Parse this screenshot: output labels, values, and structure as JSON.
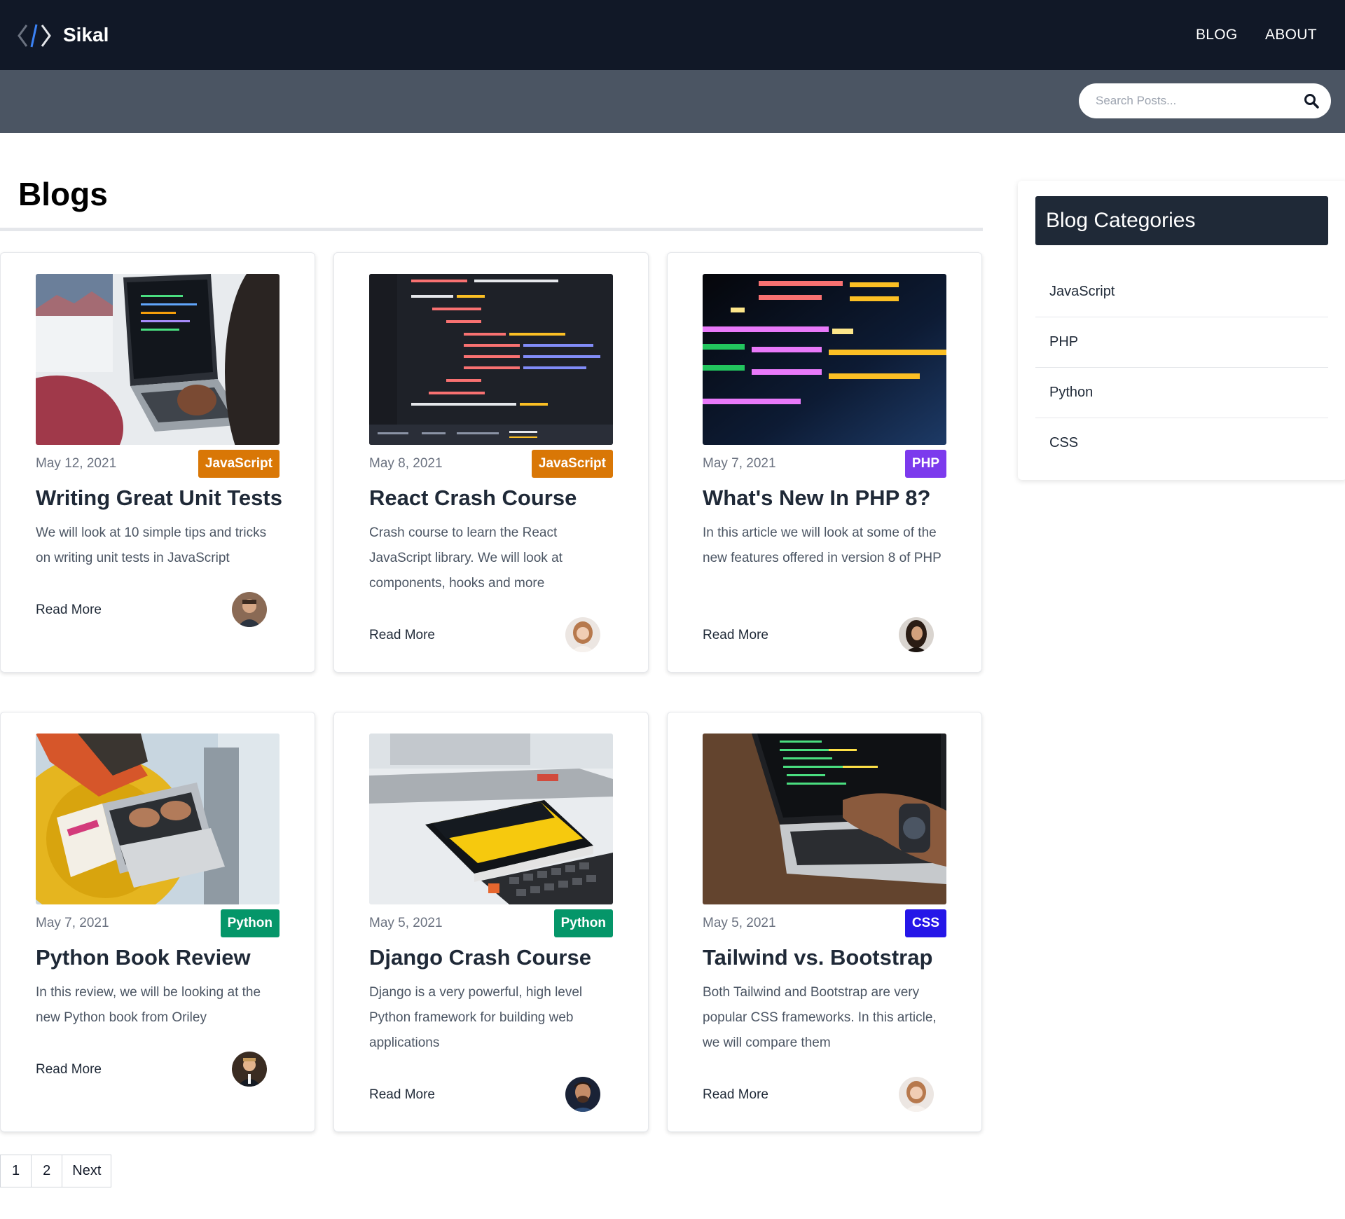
{
  "brand": {
    "name": "Sikal",
    "logo_icon": "code-brackets-icon"
  },
  "nav": {
    "blog": "BLOG",
    "about": "ABOUT"
  },
  "search": {
    "placeholder": "Search Posts...",
    "icon": "search-icon"
  },
  "page_title": "Blogs",
  "colors": {
    "header_bg": "#111827",
    "search_strip_bg": "#4b5563",
    "javascript": "#d97706",
    "php": "#7c3aed",
    "python": "#059669",
    "css": "#2516e8"
  },
  "posts": [
    {
      "date": "May 12, 2021",
      "category": "JavaScript",
      "title": "Writing Great Unit Tests",
      "description": "We will look at 10 simple tips and tricks on writing unit tests in JavaScript",
      "read_more": "Read More",
      "image": "laptop-desk-photo",
      "avatar": "man-avatar"
    },
    {
      "date": "May 8, 2021",
      "category": "JavaScript",
      "title": "React Crash Course",
      "description": "Crash course to learn the React JavaScript library. We will look at components, hooks and more",
      "read_more": "Read More",
      "image": "react-code-photo",
      "avatar": "woman-avatar"
    },
    {
      "date": "May 7, 2021",
      "category": "PHP",
      "title": "What's New In PHP 8?",
      "description": "In this article we will look at some of the new features offered in version 8 of PHP",
      "read_more": "Read More",
      "image": "php-code-photo",
      "avatar": "woman-avatar"
    },
    {
      "date": "May 7, 2021",
      "category": "Python",
      "title": "Python Book Review",
      "description": "In this review, we will be looking at the new Python book from Oriley",
      "read_more": "Read More",
      "image": "python-book-laptop-photo",
      "avatar": "man-avatar"
    },
    {
      "date": "May 5, 2021",
      "category": "Python",
      "title": "Django Crash Course",
      "description": "Django is a very powerful, high level Python framework for building web applications",
      "read_more": "Read More",
      "image": "django-book-photo",
      "avatar": "man-avatar"
    },
    {
      "date": "May 5, 2021",
      "category": "CSS",
      "title": "Tailwind vs. Bootstrap",
      "description": "Both Tailwind and Bootstrap are very popular CSS frameworks. In this article, we will compare them",
      "read_more": "Read More",
      "image": "laptop-typing-photo",
      "avatar": "woman-avatar"
    }
  ],
  "sidebar": {
    "title": "Blog Categories",
    "categories": [
      "JavaScript",
      "PHP",
      "Python",
      "CSS"
    ]
  },
  "pagination": {
    "pages": [
      "1",
      "2"
    ],
    "next": "Next"
  }
}
